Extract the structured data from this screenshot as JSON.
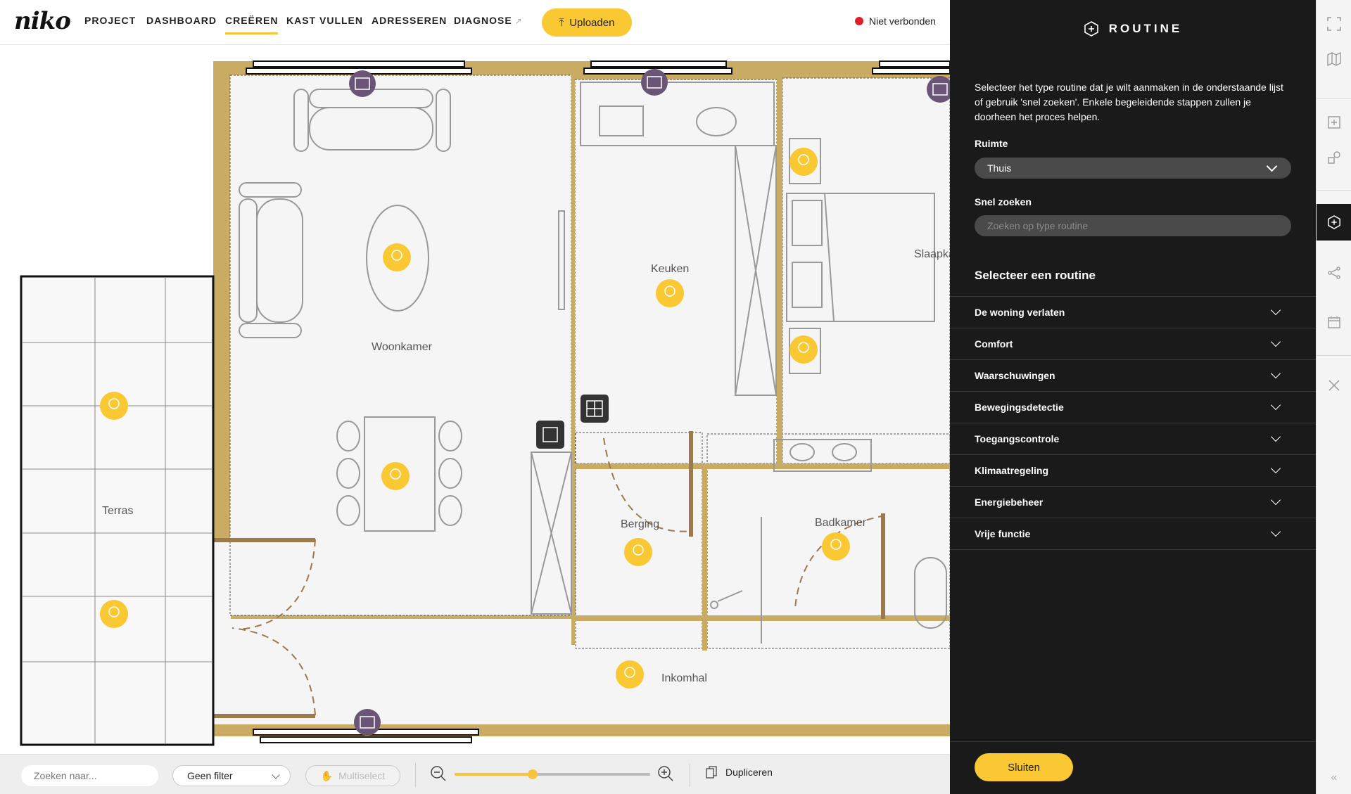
{
  "brand": {
    "logo": "niko"
  },
  "nav": [
    {
      "label": "PROJECT",
      "active": false
    },
    {
      "label": "DASHBOARD",
      "active": false
    },
    {
      "label": "CREËREN",
      "active": true
    },
    {
      "label": "KAST VULLEN",
      "active": false
    },
    {
      "label": "ADRESSEREN",
      "active": false
    },
    {
      "label": "DIAGNOSE",
      "active": false,
      "external": true
    }
  ],
  "toolbar": {
    "upload_label": "Uploaden"
  },
  "connection": {
    "status": "Niet verbonden",
    "color": "#e01e25"
  },
  "floorplan": {
    "rooms": [
      "Woonkamer",
      "Keuken",
      "Slaapka",
      "Terras",
      "Berging",
      "Badkamer",
      "Inkomhal"
    ]
  },
  "bottombar": {
    "search_placeholder": "Zoeken naar...",
    "filter_value": "Geen filter",
    "multiselect_label": "Multiselect",
    "zoom_level": 0.4,
    "duplicate_label": "Dupliceren"
  },
  "panel": {
    "title": "ROUTINE",
    "intro": "Selecteer het type routine dat je wilt aanmaken in de onderstaande lijst of gebruik 'snel zoeken'. Enkele begeleidende stappen zullen je doorheen het proces helpen.",
    "space_label": "Ruimte",
    "space_value": "Thuis",
    "quicksearch_label": "Snel zoeken",
    "quicksearch_placeholder": "Zoeken op type routine",
    "select_heading": "Selecteer een routine",
    "routines": [
      "De woning verlaten",
      "Comfort",
      "Waarschuwingen",
      "Bewegingsdetectie",
      "Toegangscontrole",
      "Klimaatregeling",
      "Energiebeheer",
      "Vrije functie"
    ],
    "close_label": "Sluiten"
  },
  "colors": {
    "accent": "#f9c832",
    "panel_bg": "#1a1a1a",
    "wall": "#c9ab64",
    "module": "#6a5577"
  }
}
